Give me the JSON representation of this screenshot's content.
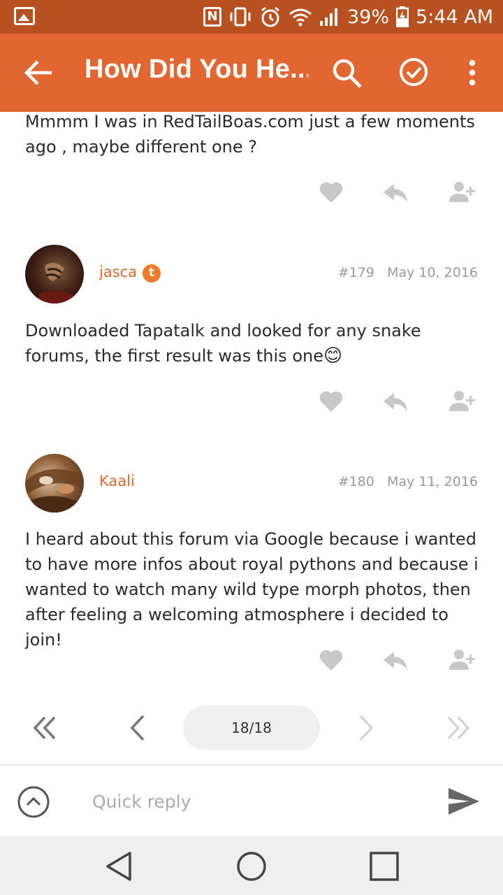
{
  "status_bar": {
    "battery": "39%",
    "time": "5:44 AM",
    "icons": [
      "gallery-icon",
      "nfc-icon",
      "vibrate-icon",
      "alarm-icon",
      "wifi-icon",
      "signal-icon",
      "battery-charging-icon"
    ]
  },
  "app_bar": {
    "title": "How Did You He...",
    "icons": [
      "back-arrow-icon",
      "search-icon",
      "check-circle-icon",
      "more-vert-icon"
    ]
  },
  "posts": [
    {
      "text": "Mmmm I was in RedTailBoas.com just a few moments ago , maybe different one ?"
    },
    {
      "username": "jasca",
      "badge": "t",
      "number": "#179",
      "date": "May 10, 2016",
      "text": "Downloaded Tapatalk and looked for any snake forums, the first result was this one",
      "emoji": "😊"
    },
    {
      "username": "Kaali",
      "number": "#180",
      "date": "May 11, 2016",
      "text": "I heard about this forum via Google because i wanted to have more infos about royal pythons and because i wanted to watch many wild type morph photos, then after feeling a welcoming atmosphere i decided to join!"
    }
  ],
  "pagination": {
    "page_indicator": "18/18"
  },
  "quick_reply": {
    "placeholder": "Quick reply"
  },
  "colors": {
    "status_bar": "#b8501f",
    "app_bar": "#e2662f",
    "username": "#e2662f",
    "icon_gray": "#c8c8c8"
  }
}
